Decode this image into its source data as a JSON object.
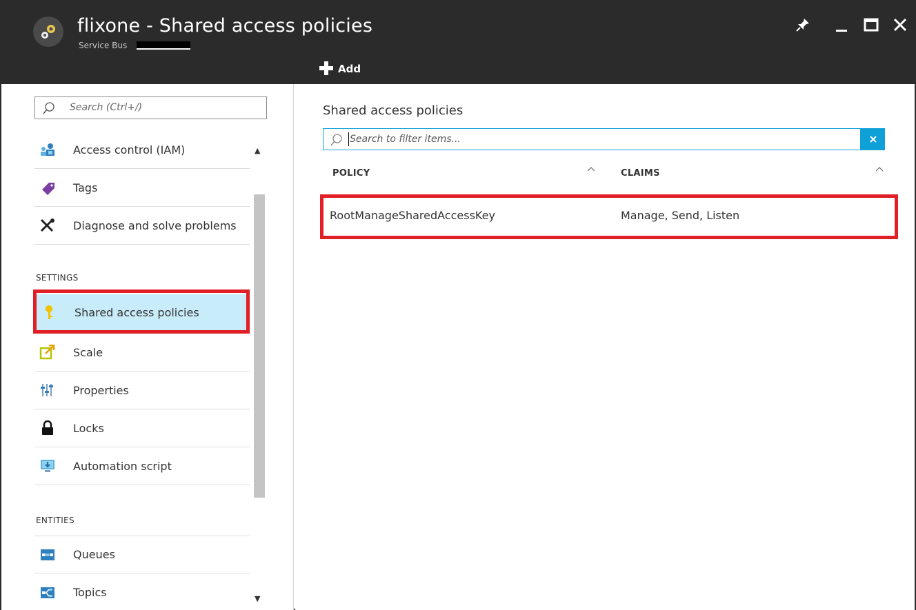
{
  "header": {
    "title": "flixone - Shared access policies",
    "subtitle": "Service Bus",
    "add_label": "Add"
  },
  "left_nav": {
    "search_placeholder": "Search (Ctrl+/)",
    "items_top": [
      {
        "label": "Access control (IAM)",
        "icon": "iam-icon"
      },
      {
        "label": "Tags",
        "icon": "tag-icon"
      },
      {
        "label": "Diagnose and solve problems",
        "icon": "wrench-icon"
      }
    ],
    "settings_label": "SETTINGS",
    "settings_items": [
      {
        "label": "Shared access policies",
        "icon": "key-icon",
        "selected": true
      },
      {
        "label": "Scale",
        "icon": "scale-icon"
      },
      {
        "label": "Properties",
        "icon": "properties-icon"
      },
      {
        "label": "Locks",
        "icon": "lock-icon"
      },
      {
        "label": "Automation script",
        "icon": "automation-icon"
      }
    ],
    "entities_label": "ENTITIES",
    "entities_items": [
      {
        "label": "Queues",
        "icon": "queues-icon"
      },
      {
        "label": "Topics",
        "icon": "topics-icon"
      }
    ]
  },
  "main": {
    "title": "Shared access policies",
    "filter_placeholder": "Search to filter items...",
    "columns": [
      "POLICY",
      "CLAIMS"
    ],
    "rows": [
      {
        "policy": "RootManageSharedAccessKey",
        "claims": "Manage, Send, Listen"
      }
    ]
  },
  "colors": {
    "header_bg": "#2b2b2b",
    "accent": "#0fa0d8",
    "selected_bg": "#c8ecf9",
    "highlight": "#e01f26"
  }
}
